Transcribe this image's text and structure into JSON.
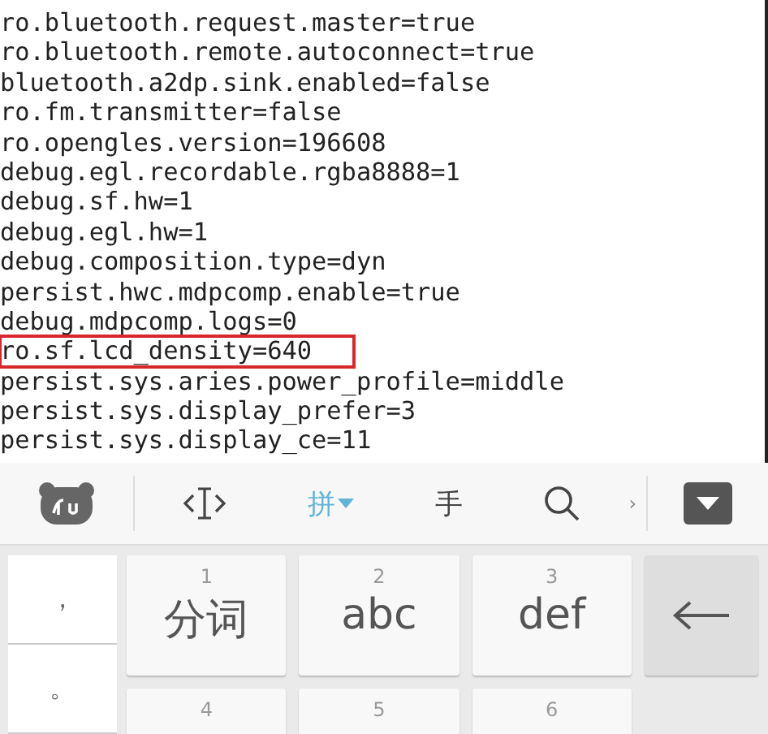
{
  "editor": {
    "lines": [
      {
        "text": "ro.bluetooth.request.master=true",
        "highlighted": false
      },
      {
        "text": "ro.bluetooth.remote.autoconnect=true",
        "highlighted": false
      },
      {
        "text": "bluetooth.a2dp.sink.enabled=false",
        "highlighted": false
      },
      {
        "text": "ro.fm.transmitter=false",
        "highlighted": false
      },
      {
        "text": "ro.opengles.version=196608",
        "highlighted": false
      },
      {
        "text": "debug.egl.recordable.rgba8888=1",
        "highlighted": false
      },
      {
        "text": "debug.sf.hw=1",
        "highlighted": false
      },
      {
        "text": "debug.egl.hw=1",
        "highlighted": false
      },
      {
        "text": "debug.composition.type=dyn",
        "highlighted": false
      },
      {
        "text": "persist.hwc.mdpcomp.enable=true",
        "highlighted": false
      },
      {
        "text": "debug.mdpcomp.logs=0",
        "highlighted": false
      },
      {
        "text": "ro.sf.lcd_density=640",
        "highlighted": true
      },
      {
        "text": "persist.sys.aries.power_profile=middle",
        "highlighted": false
      },
      {
        "text": "persist.sys.display_prefer=3",
        "highlighted": false
      },
      {
        "text": "persist.sys.display_ce=11",
        "highlighted": false
      }
    ]
  },
  "keyboard": {
    "toolbar": {
      "modes": [
        {
          "kind": "cursor",
          "selected": false
        },
        {
          "kind": "text",
          "label": "拼",
          "selected": true
        },
        {
          "kind": "text",
          "label": "手",
          "selected": false
        },
        {
          "kind": "search",
          "selected": false
        }
      ],
      "more": "›"
    },
    "side_keys": [
      "，",
      "。"
    ],
    "keys": [
      {
        "kind": "char",
        "number": "1",
        "label": "分词"
      },
      {
        "kind": "char",
        "number": "2",
        "label": "abc"
      },
      {
        "kind": "char",
        "number": "3",
        "label": "def"
      },
      {
        "kind": "backspace"
      },
      {
        "kind": "char",
        "number": "4"
      },
      {
        "kind": "char",
        "number": "5"
      },
      {
        "kind": "char",
        "number": "6"
      }
    ]
  }
}
